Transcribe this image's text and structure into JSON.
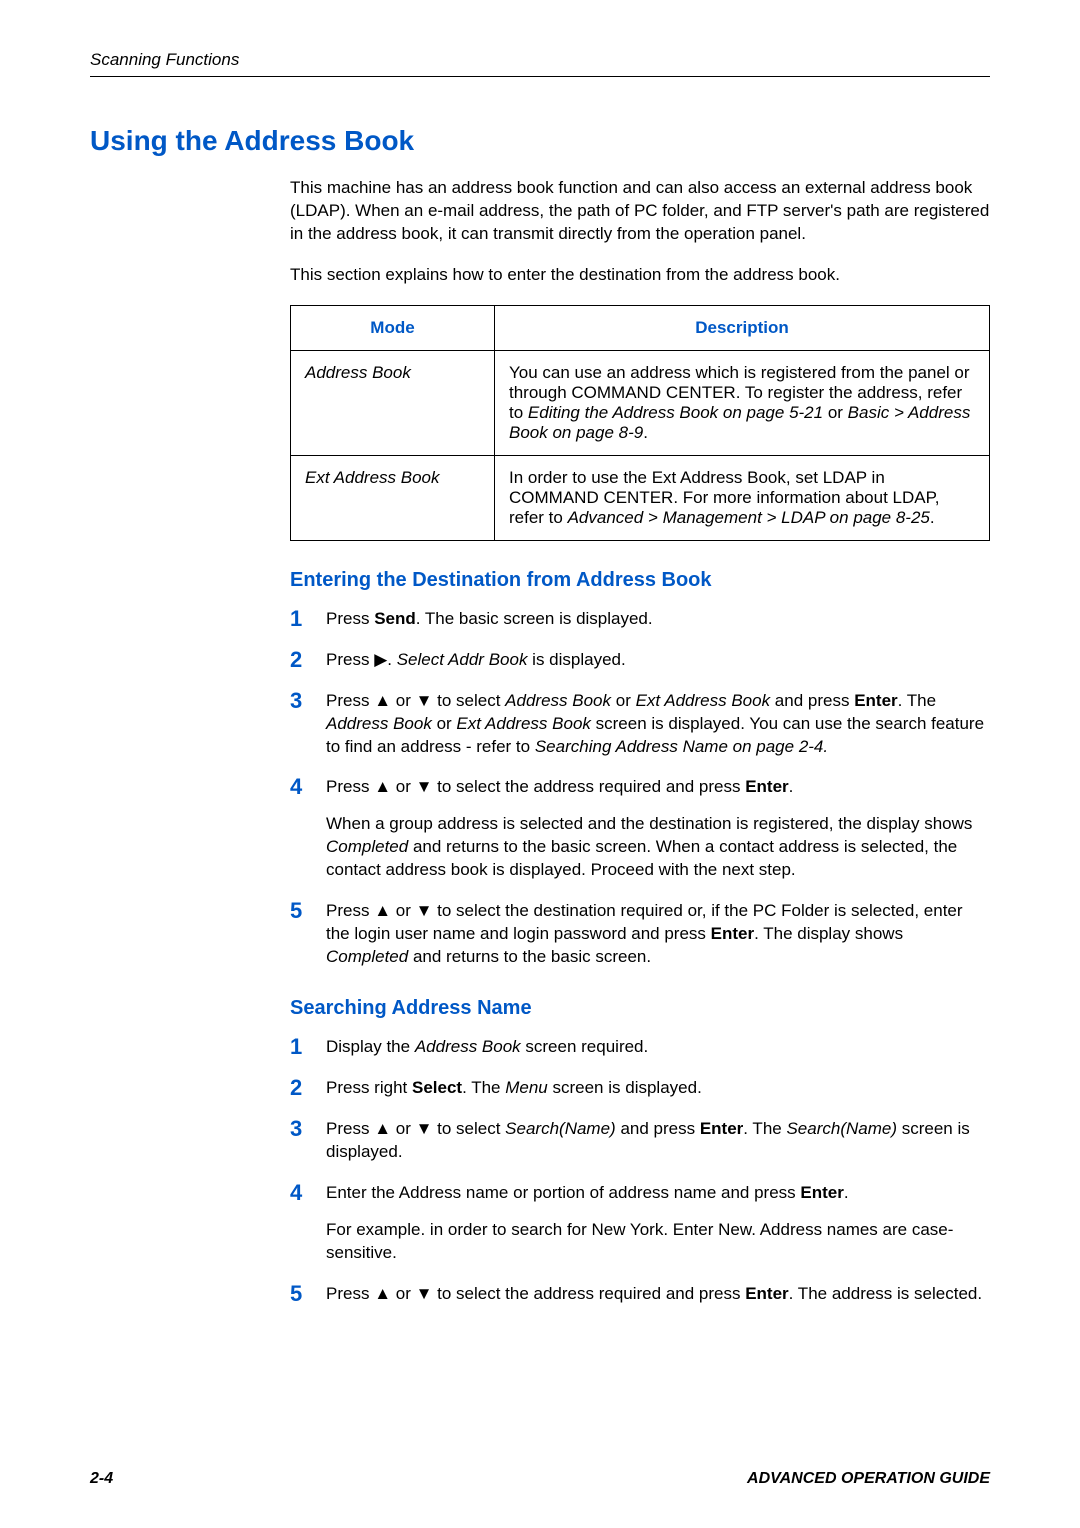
{
  "header": {
    "section": "Scanning Functions"
  },
  "title": "Using the Address Book",
  "intro": {
    "p1": "This machine has an address book function and can also access an external address book (LDAP). When an e-mail address, the path of PC folder, and FTP server's path are registered in the address book, it can transmit directly from the operation panel.",
    "p2": "This section explains how to enter the destination from the address book."
  },
  "table": {
    "head": {
      "mode": "Mode",
      "desc": "Description"
    },
    "rows": [
      {
        "mode": "Address Book",
        "desc_pre": "You can use an address which is registered from the panel or through COMMAND CENTER.\nTo register the address, refer to ",
        "link1": "Editing the Address Book on page 5-21",
        "mid": " or ",
        "link2": "Basic > Address Book on page 8-9",
        "suffix": "."
      },
      {
        "mode": "Ext Address Book",
        "desc_pre": "In order to use the Ext Address Book, set LDAP in COMMAND CENTER. For more information about LDAP, refer to ",
        "link1": "Advanced > Management > LDAP on page 8-25",
        "suffix": "."
      }
    ]
  },
  "section1": {
    "title": "Entering the Destination from Address Book",
    "steps": {
      "s1": {
        "n": "1",
        "a": "Press ",
        "b": "Send",
        "c": ". The basic screen is displayed."
      },
      "s2": {
        "n": "2",
        "a": "Press ",
        "arrow": "▶",
        "c": ". ",
        "i": "Select Addr Book",
        "d": " is displayed."
      },
      "s3": {
        "n": "3",
        "a": "Press ",
        "up": "▲",
        "or": " or ",
        "dn": "▼",
        "b": " to select ",
        "i1": "Address Book",
        "mid1": " or ",
        "i2": "Ext Address Book",
        "c": " and press ",
        "enter": "Enter",
        "d": ". The ",
        "i3": "Address Book",
        "mid2": " or ",
        "i4": "Ext Address Book",
        "e": " screen is displayed. You can use the search feature to find an address - refer to ",
        "ref": "Searching Address Name on page 2-4."
      },
      "s4": {
        "n": "4",
        "a": "Press ",
        "up": "▲",
        "or": " or ",
        "dn": "▼",
        "b": " to select the address required and press ",
        "enter": "Enter",
        "c": ".",
        "p2a": "When a group address is selected and the destination is registered, the display shows ",
        "i1": "Completed",
        "p2b": " and returns to the basic screen. When a contact address is selected, the contact address book is displayed. Proceed with the next step."
      },
      "s5": {
        "n": "5",
        "a": "Press ",
        "up": "▲",
        "or": " or ",
        "dn": "▼",
        "b": " to select the destination required or, if the PC Folder is selected, enter the login user name and login password and press ",
        "enter": "Enter",
        "c": ". The display shows ",
        "i1": "Completed",
        "d": " and returns to the basic screen."
      }
    }
  },
  "section2": {
    "title": "Searching Address Name",
    "steps": {
      "s1": {
        "n": "1",
        "a": "Display the ",
        "i": "Address Book",
        "b": " screen required."
      },
      "s2": {
        "n": "2",
        "a": "Press right ",
        "b": "Select",
        "c": ". The ",
        "i": "Menu",
        "d": " screen is displayed."
      },
      "s3": {
        "n": "3",
        "a": "Press ",
        "up": "▲",
        "or": " or ",
        "dn": "▼",
        "b": " to select ",
        "i1": "Search(Name)",
        "c": " and press ",
        "enter": "Enter",
        "d": ". The ",
        "i2": "Search(Name)",
        "e": " screen is displayed."
      },
      "s4": {
        "n": "4",
        "a": "Enter the Address name or portion of address name and press ",
        "enter": "Enter",
        "b": ".",
        "p2": "For example. in order to search for New York. Enter New. Address names are case-sensitive."
      },
      "s5": {
        "n": "5",
        "a": "Press ",
        "up": "▲",
        "or": " or ",
        "dn": "▼",
        "b": " to select the address required and press ",
        "enter": "Enter",
        "c": ". The address is selected."
      }
    }
  },
  "footer": {
    "page": "2-4",
    "guide": "ADVANCED OPERATION GUIDE"
  }
}
